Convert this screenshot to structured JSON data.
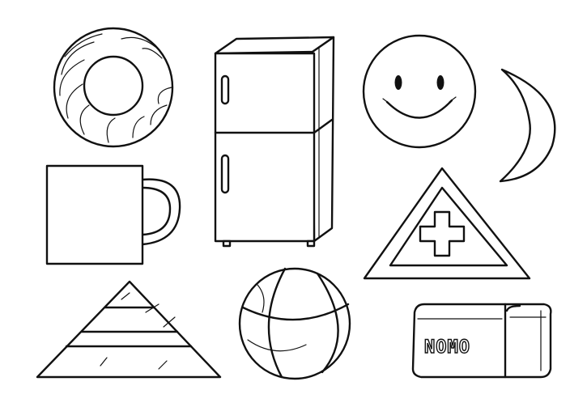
{
  "shapes": [
    {
      "id": "donut",
      "label": ""
    },
    {
      "id": "fridge",
      "label": ""
    },
    {
      "id": "smiley",
      "label": ""
    },
    {
      "id": "moon",
      "label": ""
    },
    {
      "id": "mug",
      "label": ""
    },
    {
      "id": "warning-sign",
      "label": ""
    },
    {
      "id": "pyramid",
      "label": ""
    },
    {
      "id": "basketball",
      "label": ""
    },
    {
      "id": "eraser",
      "label": "NOMO"
    }
  ],
  "colors": {
    "stroke": "#111111",
    "background": "#ffffff"
  }
}
